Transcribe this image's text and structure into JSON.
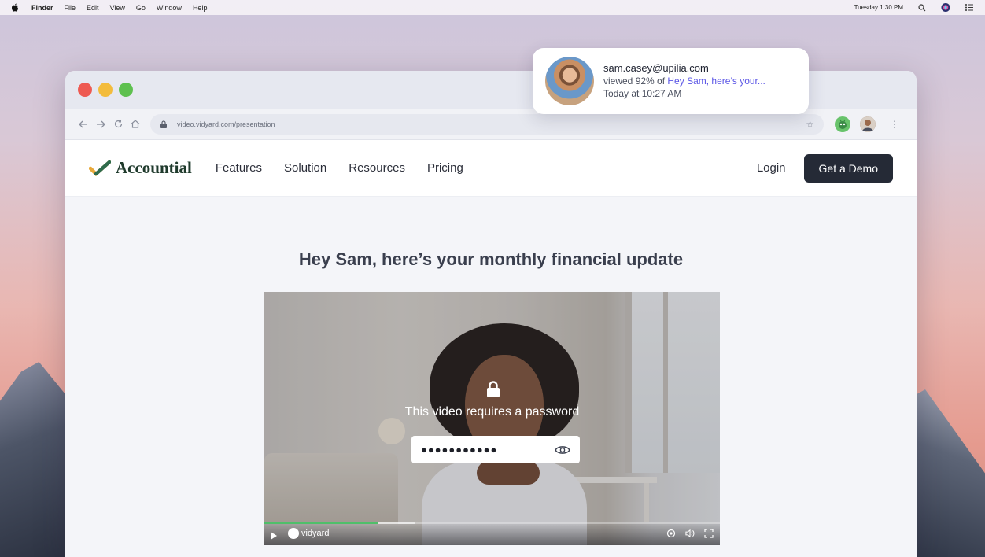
{
  "menubar": {
    "apple_icon": "apple-icon",
    "items": [
      "Finder",
      "File",
      "Edit",
      "View",
      "Go",
      "Window",
      "Help"
    ],
    "clock": "Tuesday 1:30 PM",
    "icons": [
      "search-icon",
      "siri-icon",
      "menu-list-icon"
    ]
  },
  "browser": {
    "url": "video.vidyard.com/presentation",
    "nav_icons": [
      "back-arrow-icon",
      "forward-arrow-icon",
      "reload-icon",
      "home-icon"
    ],
    "extensions": [
      "vidyard-extension-icon",
      "profile-avatar"
    ]
  },
  "site": {
    "logo_text": "Accountial",
    "nav": [
      "Features",
      "Solution",
      "Resources",
      "Pricing"
    ],
    "login": "Login",
    "cta": "Get a Demo",
    "headline": "Hey Sam, here’s your monthly financial update"
  },
  "video": {
    "password_prompt": "This video requires a password",
    "password_value": "●●●●●●●●●●●",
    "brand": "vidyard",
    "progress": 0.25,
    "buffered": 0.33,
    "colors": {
      "progress": "#4fbf6a"
    }
  },
  "notification": {
    "email": "sam.casey@upilia.com",
    "viewed_prefix": "viewed 92% of ",
    "viewed_link": "Hey Sam, here’s your...",
    "time": "Today at 10:27 AM"
  }
}
